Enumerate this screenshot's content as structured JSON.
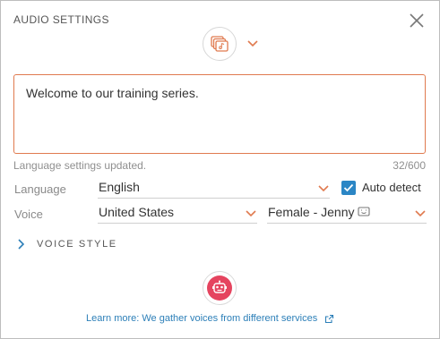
{
  "dialog": {
    "title": "AUDIO SETTINGS"
  },
  "editor": {
    "text": "Welcome to our training series.",
    "status": "Language settings updated.",
    "char_count": "32/600"
  },
  "language": {
    "label": "Language",
    "selected": "English",
    "auto_detect_label": "Auto detect",
    "auto_detect_checked": true
  },
  "voice": {
    "label": "Voice",
    "region": "United States",
    "voice_name": "Female - Jenny"
  },
  "voice_style": {
    "label": "VOICE STYLE"
  },
  "footer": {
    "learn_more": "Learn more: We gather voices from different services"
  },
  "colors": {
    "accent_orange": "#e07a4f",
    "checkbox_blue": "#2b86c5",
    "robot_pink": "#e5445f",
    "link_blue": "#2c7fb8"
  },
  "icons": {
    "media": "media-stack-icon",
    "robot": "robot-icon",
    "close": "close-icon",
    "external": "external-link-icon"
  }
}
